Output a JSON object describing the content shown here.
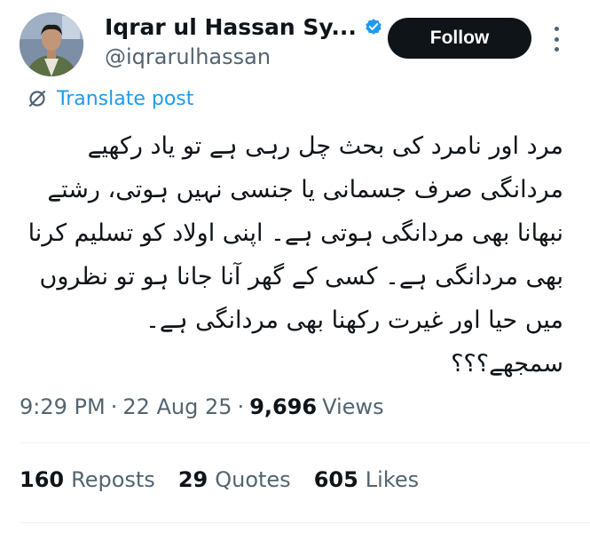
{
  "author": {
    "display_name": "Iqrar ul Hassan Sy...",
    "handle": "@iqrarulhassan",
    "verified": true,
    "verified_color": "#1d9bf0"
  },
  "follow_label": "Follow",
  "translate_label": "Translate post",
  "post": {
    "lines": [
      "مرد اور نامرد کی بحث چل رہی ہے تو یاد رکھیے",
      "مردانگی صرف جسمانی یا جنسی نہیں ہوتی، رشتے",
      "نبھانا بھی مردانگی ہوتی ہے۔ اپنی اولاد کو تسلیم کرنا",
      "بھی مردانگی ہے۔ کسی کے گھر آنا جانا ہو تو نظروں",
      "میں حیا اور غیرت رکھنا بھی مردانگی ہے۔",
      "سمجھے؟؟؟"
    ]
  },
  "meta": {
    "time": "9:29 PM",
    "separator": "·",
    "date": "22 Aug 25",
    "views_count": "9,696",
    "views_label": "Views"
  },
  "stats": {
    "reposts_count": "160",
    "reposts_label": "Reposts",
    "quotes_count": "29",
    "quotes_label": "Quotes",
    "likes_count": "605",
    "likes_label": "Likes"
  },
  "icons": {
    "avatar": "avatar-image",
    "verified": "verified-badge-icon",
    "more": "more-options-icon",
    "translate": "translate-icon"
  },
  "colors": {
    "link": "#1d9bf0",
    "secondary_text": "#536471",
    "primary_text": "#0f1419",
    "follow_bg": "#0f1419"
  }
}
